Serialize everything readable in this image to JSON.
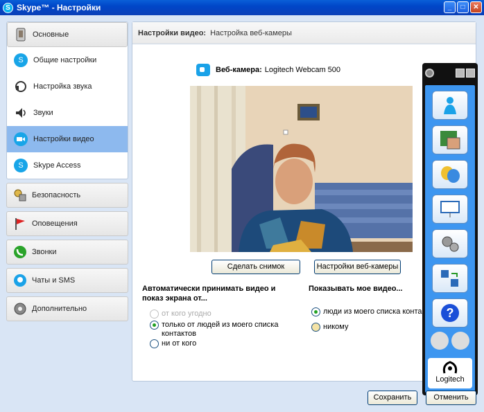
{
  "window": {
    "title": "Skype™ - Настройки",
    "min": "_",
    "max": "□",
    "close": "✕"
  },
  "sidebar": {
    "general": {
      "label": "Основные",
      "items": [
        {
          "label": "Общие настройки"
        },
        {
          "label": "Настройка звука"
        },
        {
          "label": "Звуки"
        },
        {
          "label": "Настройки видео"
        },
        {
          "label": "Skype Access"
        }
      ]
    },
    "groups": [
      {
        "label": "Безопасность"
      },
      {
        "label": "Оповещения"
      },
      {
        "label": "Звонки"
      },
      {
        "label": "Чаты и SMS"
      },
      {
        "label": "Дополнительно"
      }
    ]
  },
  "main": {
    "header_bold": "Настройки видео:",
    "header_sub": "Настройка веб-камеры",
    "webcam_label": "Веб-камера:",
    "webcam_name": "Logitech Webcam 500",
    "snapshot_button": "Сделать снимок",
    "webcam_settings_button": "Настройки веб-камеры",
    "auto_accept_title": "Автоматически принимать видео и показ экрана от...",
    "auto_accept_options": [
      "от кого угодно",
      "только от людей из моего списка контактов",
      "ни от кого"
    ],
    "show_video_title": "Показывать мое видео...",
    "show_video_options": [
      "люди из моего списка контактов",
      "никому"
    ]
  },
  "logitech": {
    "brand": "Logitech"
  },
  "footer": {
    "save": "Сохранить",
    "cancel": "Отменить"
  },
  "colors": {
    "accent": "#3d96f0",
    "selection": "#8db9ee",
    "title": "#0046c8"
  }
}
